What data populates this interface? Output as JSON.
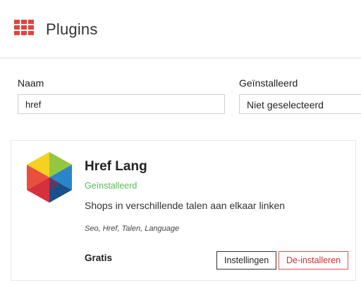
{
  "header": {
    "title": "Plugins",
    "icon": "apps-grid-icon",
    "icon_color": "#e5413a"
  },
  "filters": {
    "name_label": "Naam",
    "name_value": "href",
    "installed_label": "Geïnstalleerd",
    "installed_value": "Niet geselecteerd"
  },
  "plugin": {
    "name": "Href Lang",
    "status": "Geïnstalleerd",
    "status_color": "#5cb85c",
    "description": "Shops in verschillende talen aan elkaar linken",
    "tags": "Seo, Href, Talen, Language",
    "price": "Gratis",
    "settings_label": "Instellingen",
    "uninstall_label": "De-installeren",
    "uninstall_color": "#d9534f",
    "logo_icon": "href-lang-hexagon-logo"
  }
}
